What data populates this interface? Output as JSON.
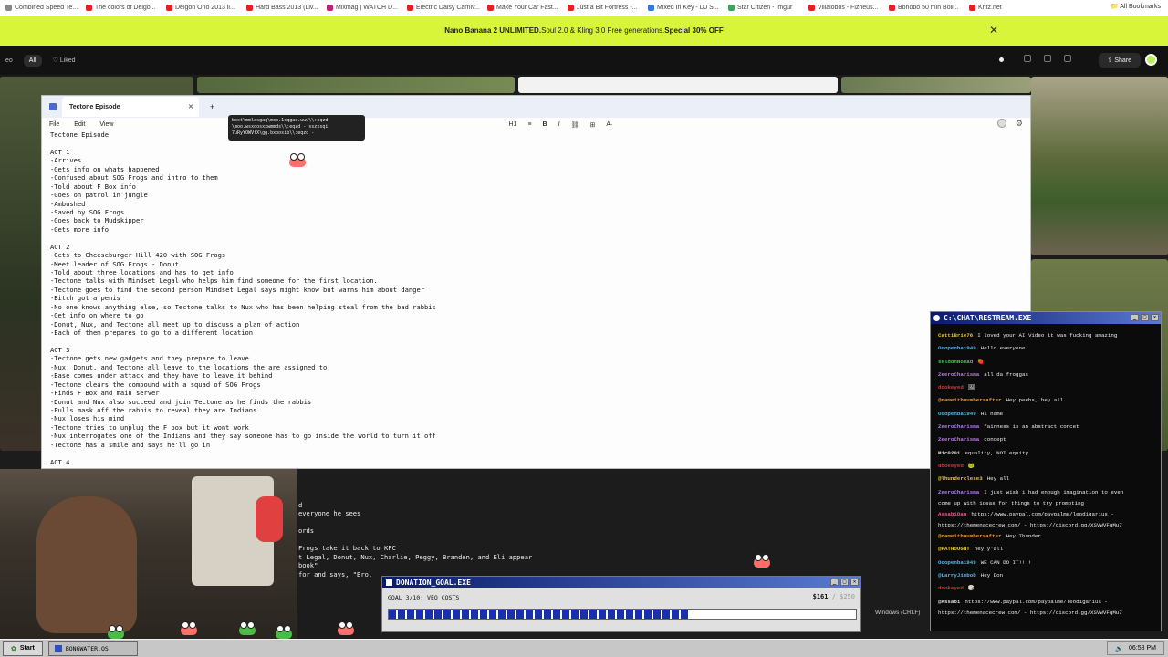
{
  "bookmarks": [
    {
      "label": "Combined Speed Te...",
      "color": "#888888"
    },
    {
      "label": "The colors of Delgo...",
      "color": "#e22222"
    },
    {
      "label": "Delgon Ono 2013 li...",
      "color": "#e22222"
    },
    {
      "label": "Hard Bass 2013 (Liv...",
      "color": "#e22222"
    },
    {
      "label": "Mixmag | WATCH D...",
      "color": "#c0207a"
    },
    {
      "label": "Electric Daisy Carniv...",
      "color": "#e22222"
    },
    {
      "label": "Make Your Car Fast...",
      "color": "#e22222"
    },
    {
      "label": "Just a Bit Fortress -...",
      "color": "#e22222"
    },
    {
      "label": "Mixed In Key - DJ S...",
      "color": "#2d7be0"
    },
    {
      "label": "Star Citizen - Imgur",
      "color": "#3aa657"
    },
    {
      "label": "Villalobos - Fizheus...",
      "color": "#e22222"
    },
    {
      "label": "Bonobo 50 min Boil...",
      "color": "#e22222"
    },
    {
      "label": "Kritz.net",
      "color": "#e22222"
    }
  ],
  "all_bookmarks": "All Bookmarks",
  "promo": {
    "brand": "Nano Banana 2 UNLIMITED.",
    "middle": " Soul 2.0 & Kling 3.0 Free generations. ",
    "offer": "Special 30% OFF"
  },
  "appbar": {
    "filter_prev": "eo",
    "filter_all": "All",
    "filter_liked": "Liked",
    "share": "Share"
  },
  "editor": {
    "tab_title": "Tectone Episode",
    "menu": [
      "File",
      "Edit",
      "View"
    ],
    "format_items": [
      "H1",
      "≡",
      "B",
      "I",
      "⛓",
      "⊞",
      "A̶"
    ],
    "tooltip": [
      "bost\\mmlasgaq\\moo.1sqgaq.www\\\\:eqzd",
      "\\moo.wsxoosxxwmmds\\\\:eqzd - sszxsqi",
      "7uRyYOWVfX\\gg.bxoosib\\\\:eqzd -"
    ],
    "lines": [
      "Tectone Episode",
      "",
      "ACT 1",
      "-Arrives",
      "-Gets info on whats happened",
      "-Confused about SOG Frogs and intro to them",
      "-Told about F Box info",
      "-Goes on patrol in jungle",
      "-Ambushed",
      "-Saved by SOG Frogs",
      "-Goes back to Mudskipper",
      "-Gets more info",
      "",
      "ACT 2",
      "-Gets to Cheeseburger Hill 420 with SOG Frogs",
      "-Meet leader of SOG Frogs - Donut",
      "-Told about three locations and has to get info",
      "-Tectone talks with Mindset Legal who helps him find someone for the first location.",
      "-Tectone goes to find the second person Mindset Legal says might know but warns him about danger",
      "-Bitch got a penis",
      "-No one knows anything else, so Tectone talks to Nux who has been helping steal from the bad rabbis",
      "-Get info on where to go",
      "-Donut, Nux, and Tectone all meet up to discuss a plan of action",
      "-Each of them prepares to go to a different location",
      "",
      "ACT 3",
      "-Tectone gets new gadgets and they prepare to leave",
      "-Nux, Donut, and Tectone all leave to the locations the are assigned to",
      "-Base comes under attack and they have to leave it behind",
      "-Tectone clears the compound with a squad of SOG Frogs",
      "-Finds F Box and main server",
      "-Donut and Nux also succeed and join Tectone as he finds the rabbis",
      "-Pulls mask off the rabbis to reveal they are Indians",
      "-Nux loses his mind",
      "-Tectone tries to unplug the F box but it wont work",
      "-Nux interrogates one of the Indians and they say someone has to go inside the world to turn it off",
      "-Tectone has a smile and says he'll go in",
      "",
      "ACT 4"
    ],
    "hidden_lines": [
      "d",
      "everyone he sees",
      "",
      "ords",
      "",
      "Frogs take it back to KFC",
      "t Legal, Donut, Nux, Charlie, Peggy, Brandon, and Eli appear",
      "book\"",
      "for and says, \"Bro,"
    ],
    "status_encoding": "Windows (CRLF)"
  },
  "chat": {
    "title": "C:\\CHAT\\RESTREAM.EXE",
    "messages": [
      {
        "user": "CattiBrie76",
        "color": "#e8c23a",
        "text": "I loved your AI Video it was fucking amazing"
      },
      {
        "user": "Ooopenba1949",
        "color": "#52b9e8",
        "text": "Hello everyone"
      },
      {
        "user": "seldonNomad",
        "color": "#3ad04a",
        "text": "🍓"
      },
      {
        "user": "ZeeroCharisma",
        "color": "#b47ae8",
        "text": "all da froggas"
      },
      {
        "user": "dookeyed",
        "color": "#d23a3a",
        "text": "🖼"
      },
      {
        "user": "@nameithnumbersafter",
        "color": "#e89a3a",
        "text": "Hey peebs, hey all"
      },
      {
        "user": "Ooopenba1949",
        "color": "#52b9e8",
        "text": "Hi name"
      },
      {
        "user": "ZeeroCharisma",
        "color": "#b47ae8",
        "text": "fairness is an abstract concet"
      },
      {
        "user": "ZeeroCharisma",
        "color": "#b47ae8",
        "text": "concept"
      },
      {
        "user": "Mic0201",
        "color": "#dddddd",
        "text": "equality, NOT equity"
      },
      {
        "user": "dookeyed",
        "color": "#d23a3a",
        "text": "🐸"
      },
      {
        "user": "@Thunderclese3",
        "color": "#e8c23a",
        "text": "Hey all"
      },
      {
        "user": "ZeeroCharisma",
        "color": "#b47ae8",
        "text": "I just wish i had enough imagination to even",
        "cont": "come up with ideas for things to try prompting"
      },
      {
        "user": "AssabiDan",
        "color": "#e85a8a",
        "text": "https://www.paypal.com/paypalme/leodigarius -",
        "cont": "https://themenacecrew.com/ - https://discord.gg/XSVWVFqMu7"
      },
      {
        "user": "@nameithnumbersafter",
        "color": "#e89a3a",
        "text": "Hey Thunder"
      },
      {
        "user": "@PATHOUGHT",
        "color": "#e8c23a",
        "text": "hey y'all"
      },
      {
        "user": "Ooopenba1949",
        "color": "#52b9e8",
        "text": "WE CAN DO IT!!!!"
      },
      {
        "user": "@LarryJimbob",
        "color": "#52b9e8",
        "text": "Hey Don"
      },
      {
        "user": "dookeyed",
        "color": "#d23a3a",
        "text": "🎲"
      },
      {
        "user": "@Assabi",
        "color": "#dddddd",
        "text": "https://www.paypal.com/paypalme/leodigarius -",
        "cont": "https://themenacecrew.com/ - https://discord.gg/XSVWVFqMu7"
      }
    ]
  },
  "donation": {
    "title": "DONATION_GOAL.EXE",
    "label": "GOAL 3/10: VEO COSTS",
    "raised": "$161",
    "goal": "/ $250",
    "progress": 0.644,
    "accent": "#1a2fb0"
  },
  "taskbar": {
    "start": "Start",
    "item": "BONGWATER.OS",
    "clock": "06:58 PM"
  }
}
